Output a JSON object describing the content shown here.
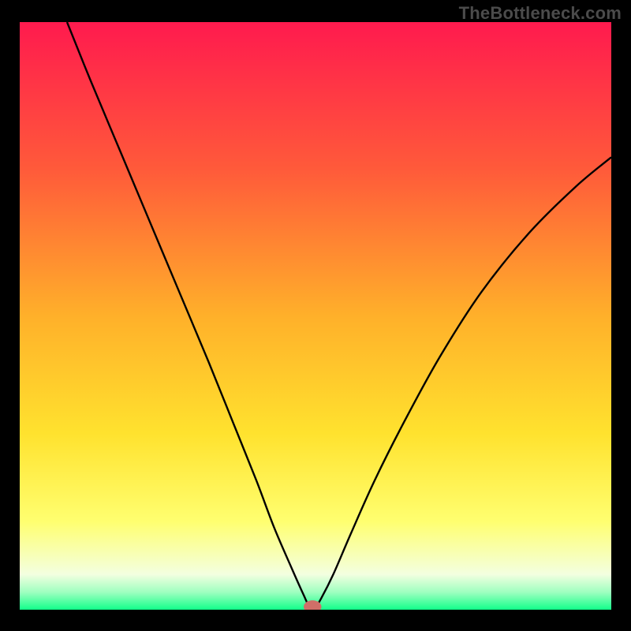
{
  "watermark": "TheBottleneck.com",
  "chart_data": {
    "type": "line",
    "title": "",
    "xlabel": "",
    "ylabel": "",
    "xlim": [
      0,
      100
    ],
    "ylim": [
      0,
      100
    ],
    "background": {
      "style": "vertical-gradient",
      "stops": [
        {
          "offset": 0.0,
          "color": "#ff1a4e"
        },
        {
          "offset": 0.25,
          "color": "#ff5a3a"
        },
        {
          "offset": 0.5,
          "color": "#ffb02a"
        },
        {
          "offset": 0.7,
          "color": "#ffe22e"
        },
        {
          "offset": 0.85,
          "color": "#ffff70"
        },
        {
          "offset": 0.94,
          "color": "#f3ffe0"
        },
        {
          "offset": 0.97,
          "color": "#9fffc0"
        },
        {
          "offset": 1.0,
          "color": "#12ff8a"
        }
      ]
    },
    "series": [
      {
        "name": "bottleneck-curve",
        "color": "#000000",
        "points": [
          {
            "x": 8.0,
            "y": 100.0
          },
          {
            "x": 12.0,
            "y": 90.0
          },
          {
            "x": 17.0,
            "y": 78.0
          },
          {
            "x": 22.0,
            "y": 66.0
          },
          {
            "x": 27.0,
            "y": 54.0
          },
          {
            "x": 32.0,
            "y": 42.0
          },
          {
            "x": 36.0,
            "y": 32.0
          },
          {
            "x": 40.0,
            "y": 22.0
          },
          {
            "x": 43.0,
            "y": 14.0
          },
          {
            "x": 46.0,
            "y": 7.0
          },
          {
            "x": 48.0,
            "y": 2.5
          },
          {
            "x": 49.0,
            "y": 0.5
          },
          {
            "x": 50.0,
            "y": 0.5
          },
          {
            "x": 51.0,
            "y": 2.0
          },
          {
            "x": 53.0,
            "y": 6.0
          },
          {
            "x": 56.0,
            "y": 13.0
          },
          {
            "x": 60.0,
            "y": 22.0
          },
          {
            "x": 65.0,
            "y": 32.0
          },
          {
            "x": 71.0,
            "y": 43.0
          },
          {
            "x": 78.0,
            "y": 54.0
          },
          {
            "x": 86.0,
            "y": 64.0
          },
          {
            "x": 94.0,
            "y": 72.0
          },
          {
            "x": 100.0,
            "y": 77.0
          }
        ]
      }
    ],
    "marker": {
      "name": "optimal-point",
      "x": 49.5,
      "y": 0.5,
      "rx": 1.5,
      "ry": 1.1,
      "color": "#cf6f68"
    }
  }
}
